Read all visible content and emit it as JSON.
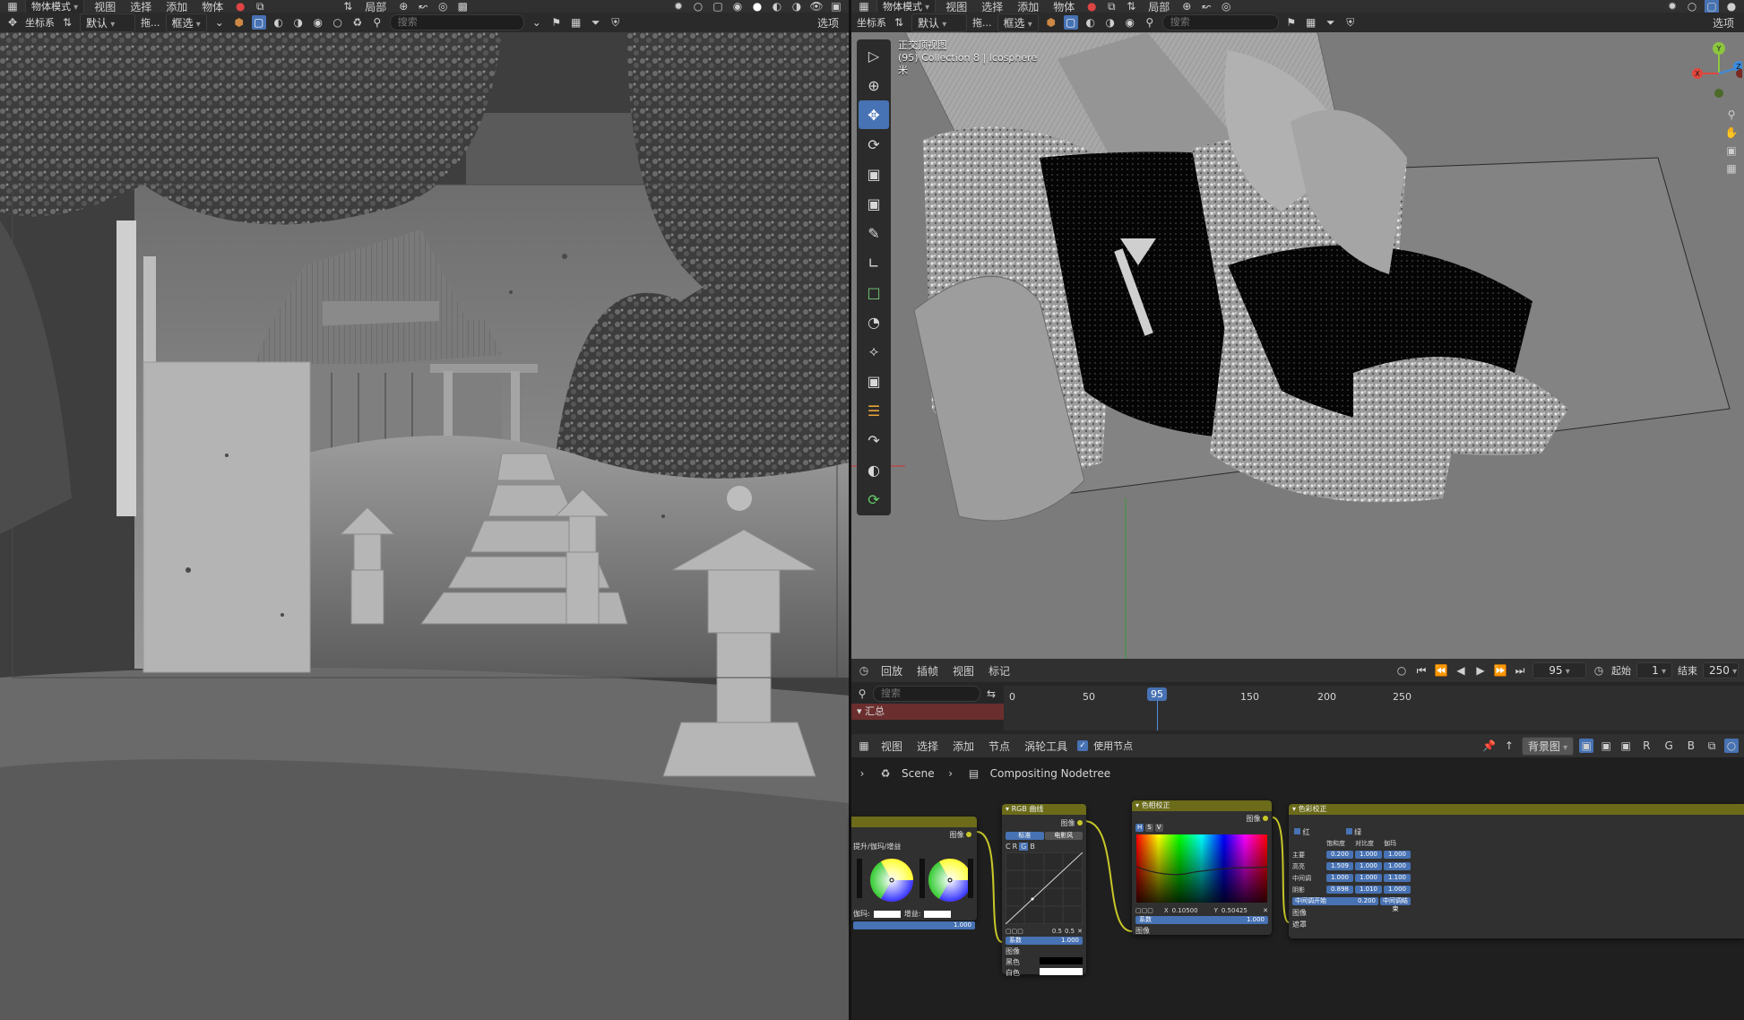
{
  "left_viewport": {
    "header": {
      "mode": "物体模式",
      "menus": [
        "视图",
        "选择",
        "添加",
        "物体"
      ],
      "transform": "局部"
    },
    "toolbar": {
      "coords_label": "坐标系",
      "coords_value": "默认",
      "drag_label": "拖...",
      "select_mode": "框选",
      "search_placeholder": "搜索",
      "options": "选项"
    }
  },
  "right_viewport": {
    "header": {
      "mode": "物体模式",
      "menus": [
        "视图",
        "选择",
        "添加",
        "物体"
      ],
      "transform": "局部"
    },
    "toolbar": {
      "coords_label": "坐标系",
      "coords_value": "默认",
      "drag_label": "拖...",
      "select_mode": "框选",
      "search_placeholder": "搜索",
      "options": "选项"
    },
    "overlay": {
      "view_name": "正交顶视图",
      "collection_info": "(95) Collection 8 | Icosphere",
      "units": "米"
    },
    "gizmo_axes": [
      "Y",
      "X",
      "Z"
    ]
  },
  "timeline": {
    "menus": [
      "回放",
      "插帧",
      "视图",
      "标记"
    ],
    "current_frame": "95",
    "start_label": "起始",
    "start_value": "1",
    "end_label": "结束",
    "end_value": "250",
    "search_placeholder": "搜索",
    "summary_label": "汇总",
    "ruler": [
      "0",
      "50",
      "95",
      "150",
      "200",
      "250"
    ]
  },
  "compositor": {
    "menus": [
      "视图",
      "选择",
      "添加",
      "节点",
      "涡轮工具"
    ],
    "use_nodes_label": "使用节点",
    "backdrop_label": "背景图",
    "channels": [
      "R",
      "G",
      "B"
    ],
    "breadcrumb_scene": "Scene",
    "breadcrumb_tree": "Compositing Nodetree",
    "nodes": {
      "color_balance": {
        "output": "图像",
        "method": "提升/伽玛/增益",
        "gamma_label": "伽玛:",
        "gain_label": "增益:",
        "factor": "1.000"
      },
      "rgb_curves": {
        "title": "RGB 曲线",
        "output": "图像",
        "tab_color": "标准",
        "tab_film": "电影风",
        "channels": [
          "C",
          "R",
          "G",
          "B"
        ],
        "factor_label": "系数",
        "factor": "1.000",
        "input_image": "图像",
        "black_label": "黑色",
        "white_label": "白色",
        "curve_values": [
          "0.5",
          "0.5"
        ]
      },
      "hue_correct": {
        "title": "色相校正",
        "output": "图像",
        "channels": [
          "H",
          "S",
          "V"
        ],
        "x_label": "X",
        "x_value": "0.10500",
        "y_label": "Y",
        "y_value": "0.50425",
        "factor_label": "系数",
        "factor": "1.000",
        "input_image": "图像"
      },
      "color_correction": {
        "title": "色彩校正",
        "red_label": "红",
        "green_label": "绿",
        "col_saturation": "饱和度",
        "col_contrast": "对比度",
        "col_gamma": "伽玛",
        "rows": [
          {
            "label": "主要",
            "values": [
              "0.200",
              "1.000",
              "1.000"
            ]
          },
          {
            "label": "高亮",
            "values": [
              "1.509",
              "1.000",
              "1.000"
            ]
          },
          {
            "label": "中间调",
            "values": [
              "1.000",
              "1.000",
              "1.100"
            ]
          },
          {
            "label": "阴影",
            "values": [
              "0.898",
              "1.010",
              "1.000"
            ]
          }
        ],
        "midtones_start_label": "中间调开始",
        "midtones_start": "0.200",
        "midtones_end_label": "中间调结束",
        "input_image": "图像",
        "input_mask": "遮罩"
      }
    }
  }
}
